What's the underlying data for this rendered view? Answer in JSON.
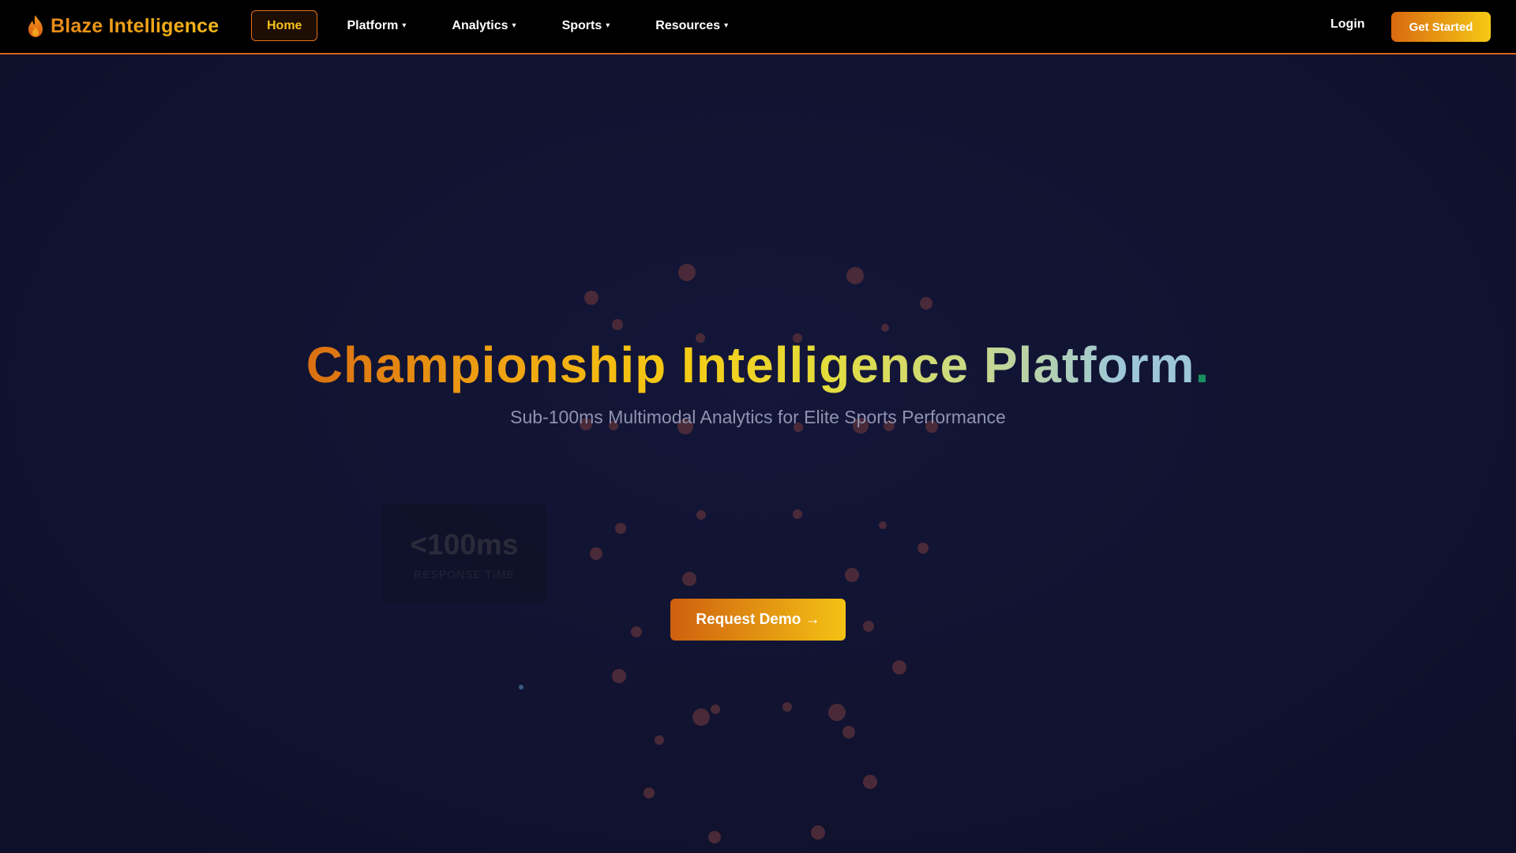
{
  "nav": {
    "brand": "Blaze Intelligence",
    "brand_icon": "flame-icon",
    "items": [
      {
        "label": "Home",
        "active": true,
        "dropdown": false
      },
      {
        "label": "Platform",
        "active": false,
        "dropdown": true
      },
      {
        "label": "Analytics",
        "active": false,
        "dropdown": true
      },
      {
        "label": "Sports",
        "active": false,
        "dropdown": true
      },
      {
        "label": "Resources",
        "active": false,
        "dropdown": true
      }
    ],
    "caret": "▾",
    "login_label": "Login",
    "get_started_label": "Get Started"
  },
  "hero": {
    "title": "Championship Intelligence Platform",
    "title_period": ".",
    "subtitle": "Sub-100ms Multimodal Analytics for Elite Sports Performance",
    "cta_label": "Request Demo →"
  },
  "stat": {
    "value": "<100ms",
    "label": "RESPONSE TIME"
  },
  "colors": {
    "accent_orange": "#d9621d",
    "accent_gold": "#f6c21d",
    "background": "#111331",
    "subtitle_text": "#8f93b0",
    "title_period": "#199060"
  }
}
